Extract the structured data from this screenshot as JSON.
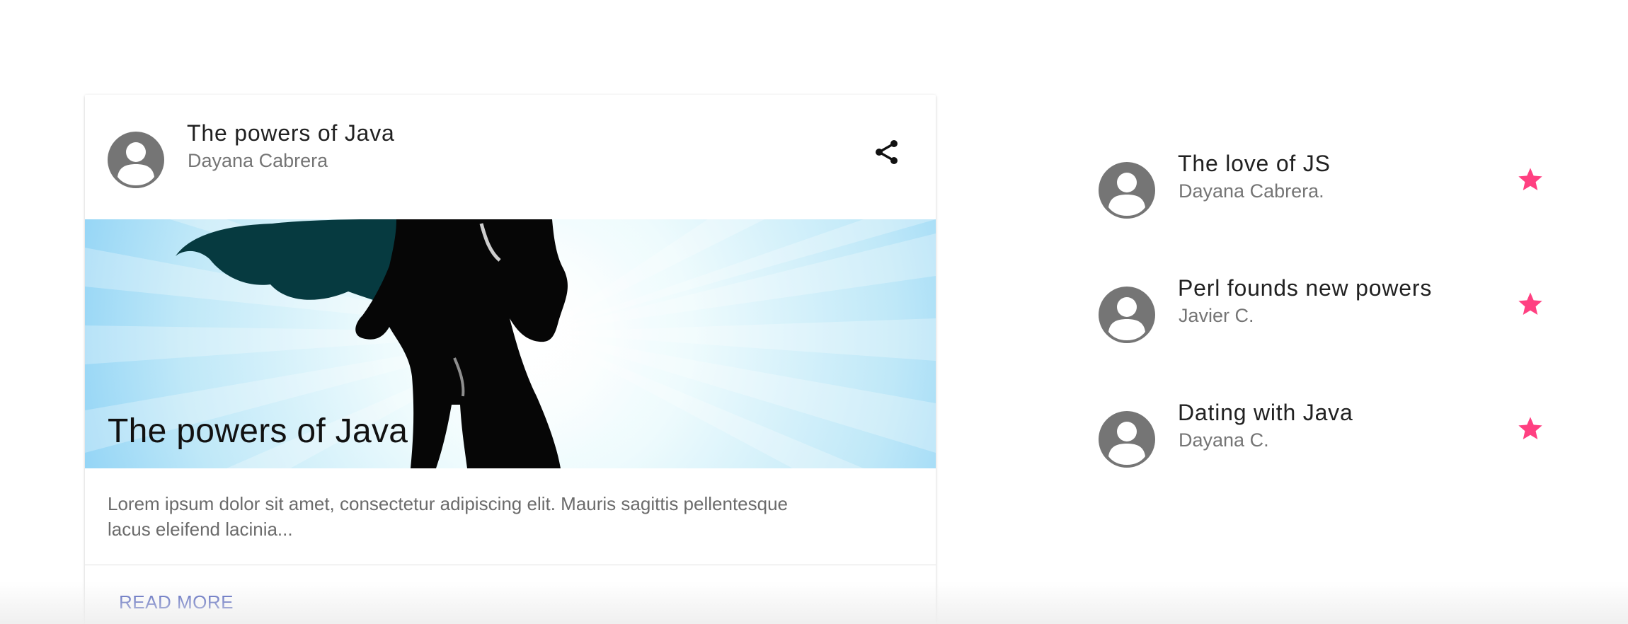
{
  "card": {
    "title": "The powers of Java",
    "subtitle": "Dayana Cabrera",
    "media_title": "The powers of Java",
    "body": "Lorem ipsum dolor sit amet, consectetur adipiscing elit. Mauris sagittis pellentesque lacus eleifend lacinia...",
    "action_label": "READ MORE"
  },
  "list": [
    {
      "title": "The love of JS",
      "subtitle": "Dayana Cabrera."
    },
    {
      "title": "Perl founds new powers",
      "subtitle": "Javier C."
    },
    {
      "title": "Dating with Java",
      "subtitle": "Dayana C."
    }
  ],
  "icons": {
    "avatar": "account-circle-icon",
    "share": "share-icon",
    "star": "star-icon"
  },
  "colors": {
    "accent": "#ff4081",
    "link": "#3f51b5",
    "avatar": "#757575",
    "title_text": "#212121",
    "secondary_text": "#757575"
  }
}
